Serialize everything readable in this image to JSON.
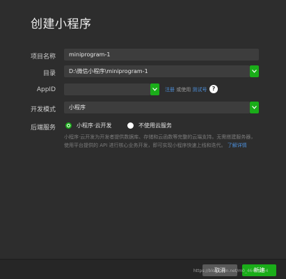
{
  "dialog": {
    "title": "创建小程序"
  },
  "form": {
    "project_name": {
      "label": "项目名称",
      "value": "miniprogram-1"
    },
    "directory": {
      "label": "目录",
      "value": "D:\\微信小程序\\miniprogram-1"
    },
    "appid": {
      "label": "AppID",
      "value": "",
      "register_link": "注册",
      "or_text": "或使用",
      "test_id_link": "测试号",
      "help": "?"
    },
    "dev_mode": {
      "label": "开发模式",
      "value": "小程序"
    },
    "backend": {
      "label": "后端服务",
      "options": [
        "小程序·云开发",
        "不使用云服务"
      ],
      "selected": "小程序·云开发",
      "description": "小程序·云开发为开发者提供数据库、存储和云函数等完整的云端支持。无需搭建服务器，使用平台提供的 API 进行核心业务开发，即可实现小程序快速上线和迭代。",
      "learn_more": "了解详情"
    }
  },
  "footer": {
    "cancel_label": "取消",
    "create_label": "新建"
  },
  "watermark": "https://blog.csdn.net/m0_46433964",
  "colors": {
    "background": "#2d2d2d",
    "field": "#3d3d3d",
    "accent": "#1aad19",
    "link": "#4c8ed9"
  },
  "icons": {
    "dropdown": "chevron-down-icon",
    "help": "question-circle-icon"
  }
}
